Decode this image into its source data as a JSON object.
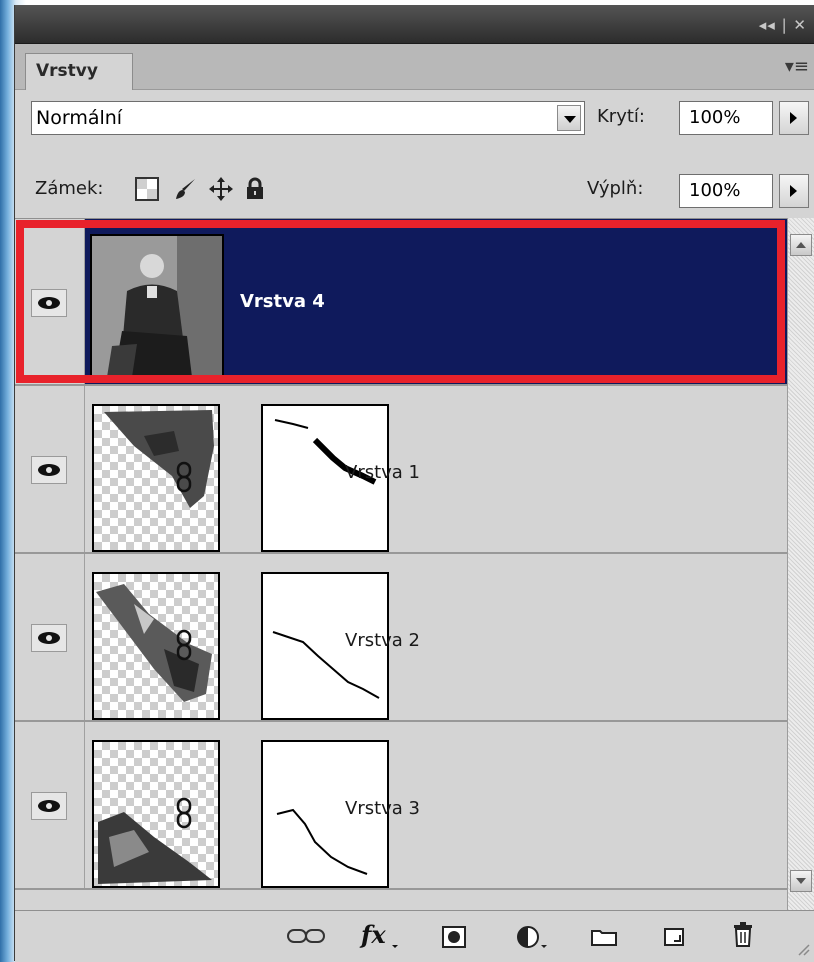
{
  "panel": {
    "tab_label": "Vrstvy",
    "blend_mode": "Normální",
    "opacity_label": "Krytí:",
    "opacity_value": "100%",
    "lock_label": "Zámek:",
    "fill_label": "Výplň:",
    "fill_value": "100%"
  },
  "layers": [
    {
      "name": "Vrstva 4",
      "selected": true,
      "has_mask": false
    },
    {
      "name": "Vrstva 1",
      "selected": false,
      "has_mask": true
    },
    {
      "name": "Vrstva 2",
      "selected": false,
      "has_mask": true
    },
    {
      "name": "Vrstva 3",
      "selected": false,
      "has_mask": true
    }
  ],
  "icons": {
    "lock": [
      "lock-transparent-icon",
      "lock-paint-icon",
      "lock-move-icon",
      "lock-all-icon"
    ],
    "bottom": [
      "link-layers-icon",
      "fx-icon",
      "add-mask-icon",
      "adjustment-layer-icon",
      "new-group-icon",
      "new-layer-icon",
      "delete-layer-icon"
    ]
  },
  "colors": {
    "selected_layer": "#0f1a5c",
    "highlight_frame": "#e8222b",
    "panel_bg": "#d4d4d4"
  }
}
